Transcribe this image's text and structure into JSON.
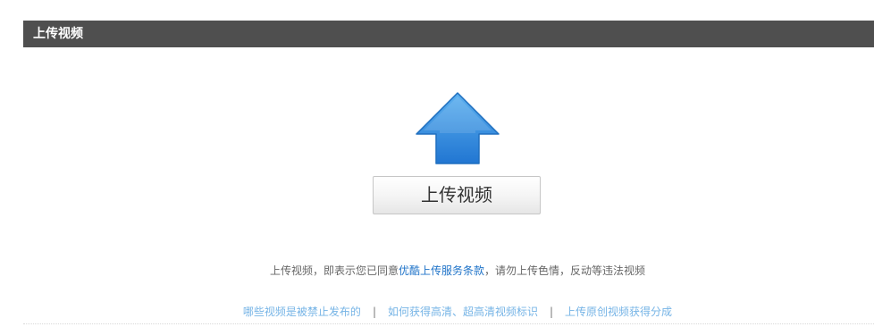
{
  "header": {
    "title": "上传视频"
  },
  "upload": {
    "icon": "up-arrow-icon",
    "button_label": "上传视频"
  },
  "terms": {
    "prefix": "上传视频，即表示您已同意",
    "link_text": "优酷上传服务条款",
    "suffix": "，请勿上传色情，反动等违法视频"
  },
  "help_links": [
    {
      "label": "哪些视频是被禁止发布的"
    },
    {
      "label": "如何获得高清、超高清视频标识"
    },
    {
      "label": "上传原创视频获得分成"
    }
  ],
  "separator": "|",
  "colors": {
    "header_bg": "#4f4f4f",
    "arrow_top": "#5cb0ef",
    "arrow_bottom": "#2176d2",
    "terms_link": "#1f73c8",
    "help_link": "#76b4e6"
  }
}
